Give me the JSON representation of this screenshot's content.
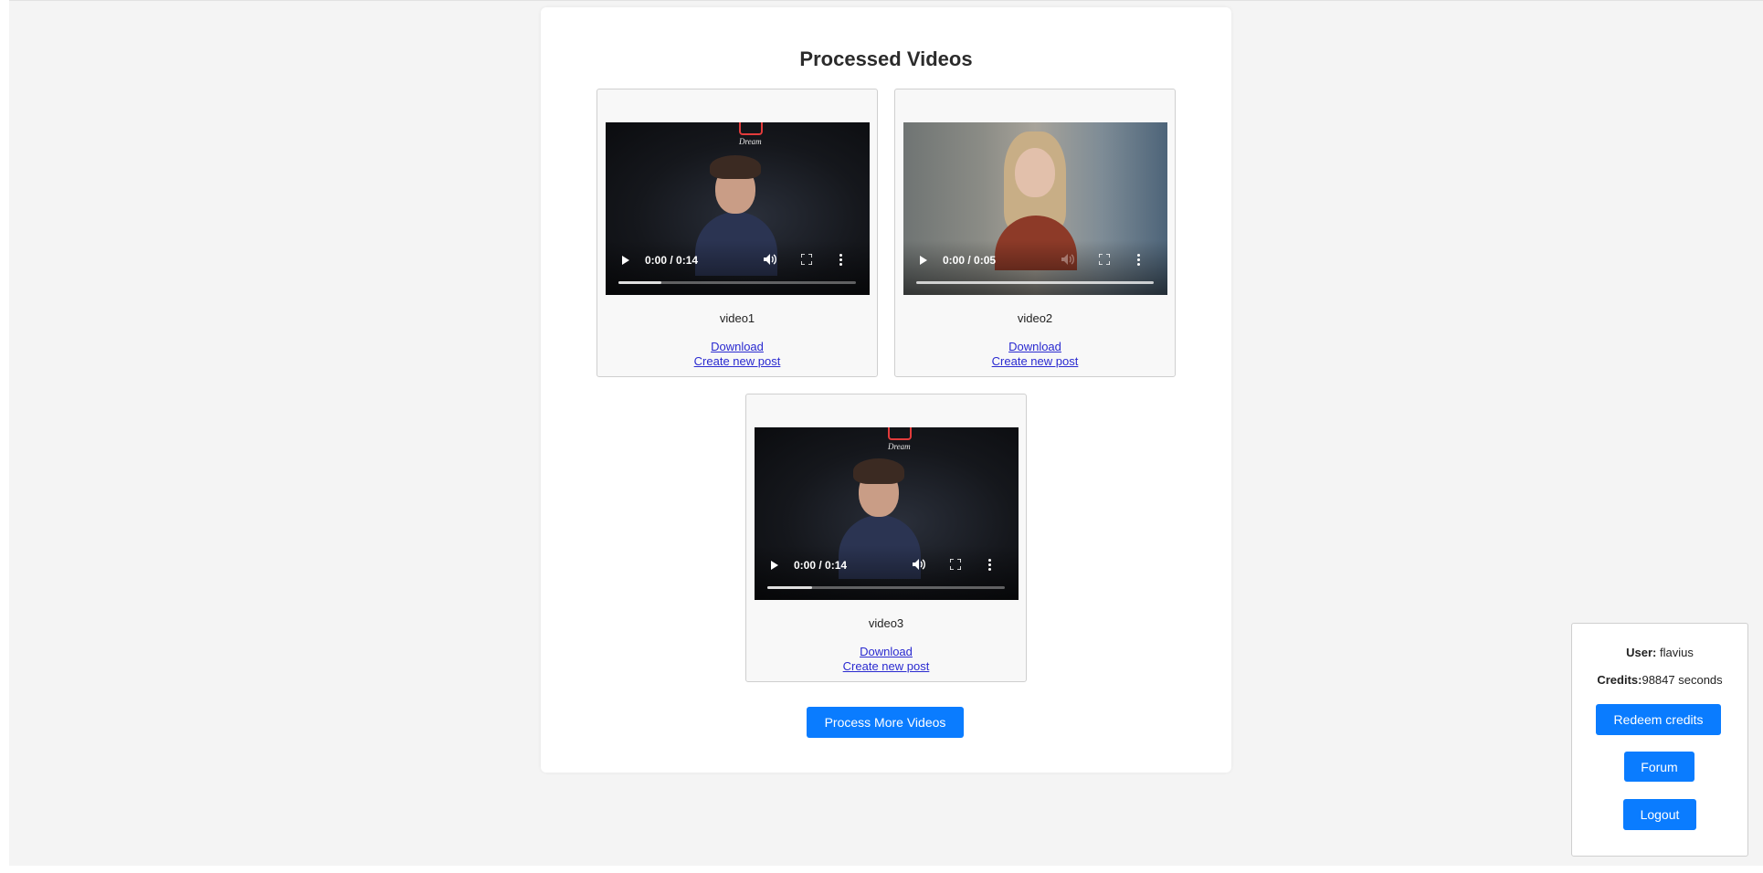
{
  "main": {
    "title": "Processed Videos",
    "videos": [
      {
        "name": "video1",
        "time": "0:00 / 0:14",
        "progress": 0.18,
        "muted": false,
        "download_label": "Download",
        "create_post_label": "Create new post",
        "sign_text": "Dream"
      },
      {
        "name": "video2",
        "time": "0:00 / 0:05",
        "progress": 0.0,
        "muted": true,
        "download_label": "Download",
        "create_post_label": "Create new post"
      },
      {
        "name": "video3",
        "time": "0:00 / 0:14",
        "progress": 0.19,
        "muted": false,
        "download_label": "Download",
        "create_post_label": "Create new post",
        "sign_text": "Dream"
      }
    ],
    "process_more_label": "Process More Videos"
  },
  "user_panel": {
    "user_label": "User:",
    "user_name": "flavius",
    "credits_label": "Credits:",
    "credits_value": "98847 seconds",
    "redeem_label": "Redeem credits",
    "forum_label": "Forum",
    "logout_label": "Logout"
  },
  "colors": {
    "accent": "#0a7cff",
    "link": "#2a2ad0",
    "page_background": "#f4f4f4"
  }
}
